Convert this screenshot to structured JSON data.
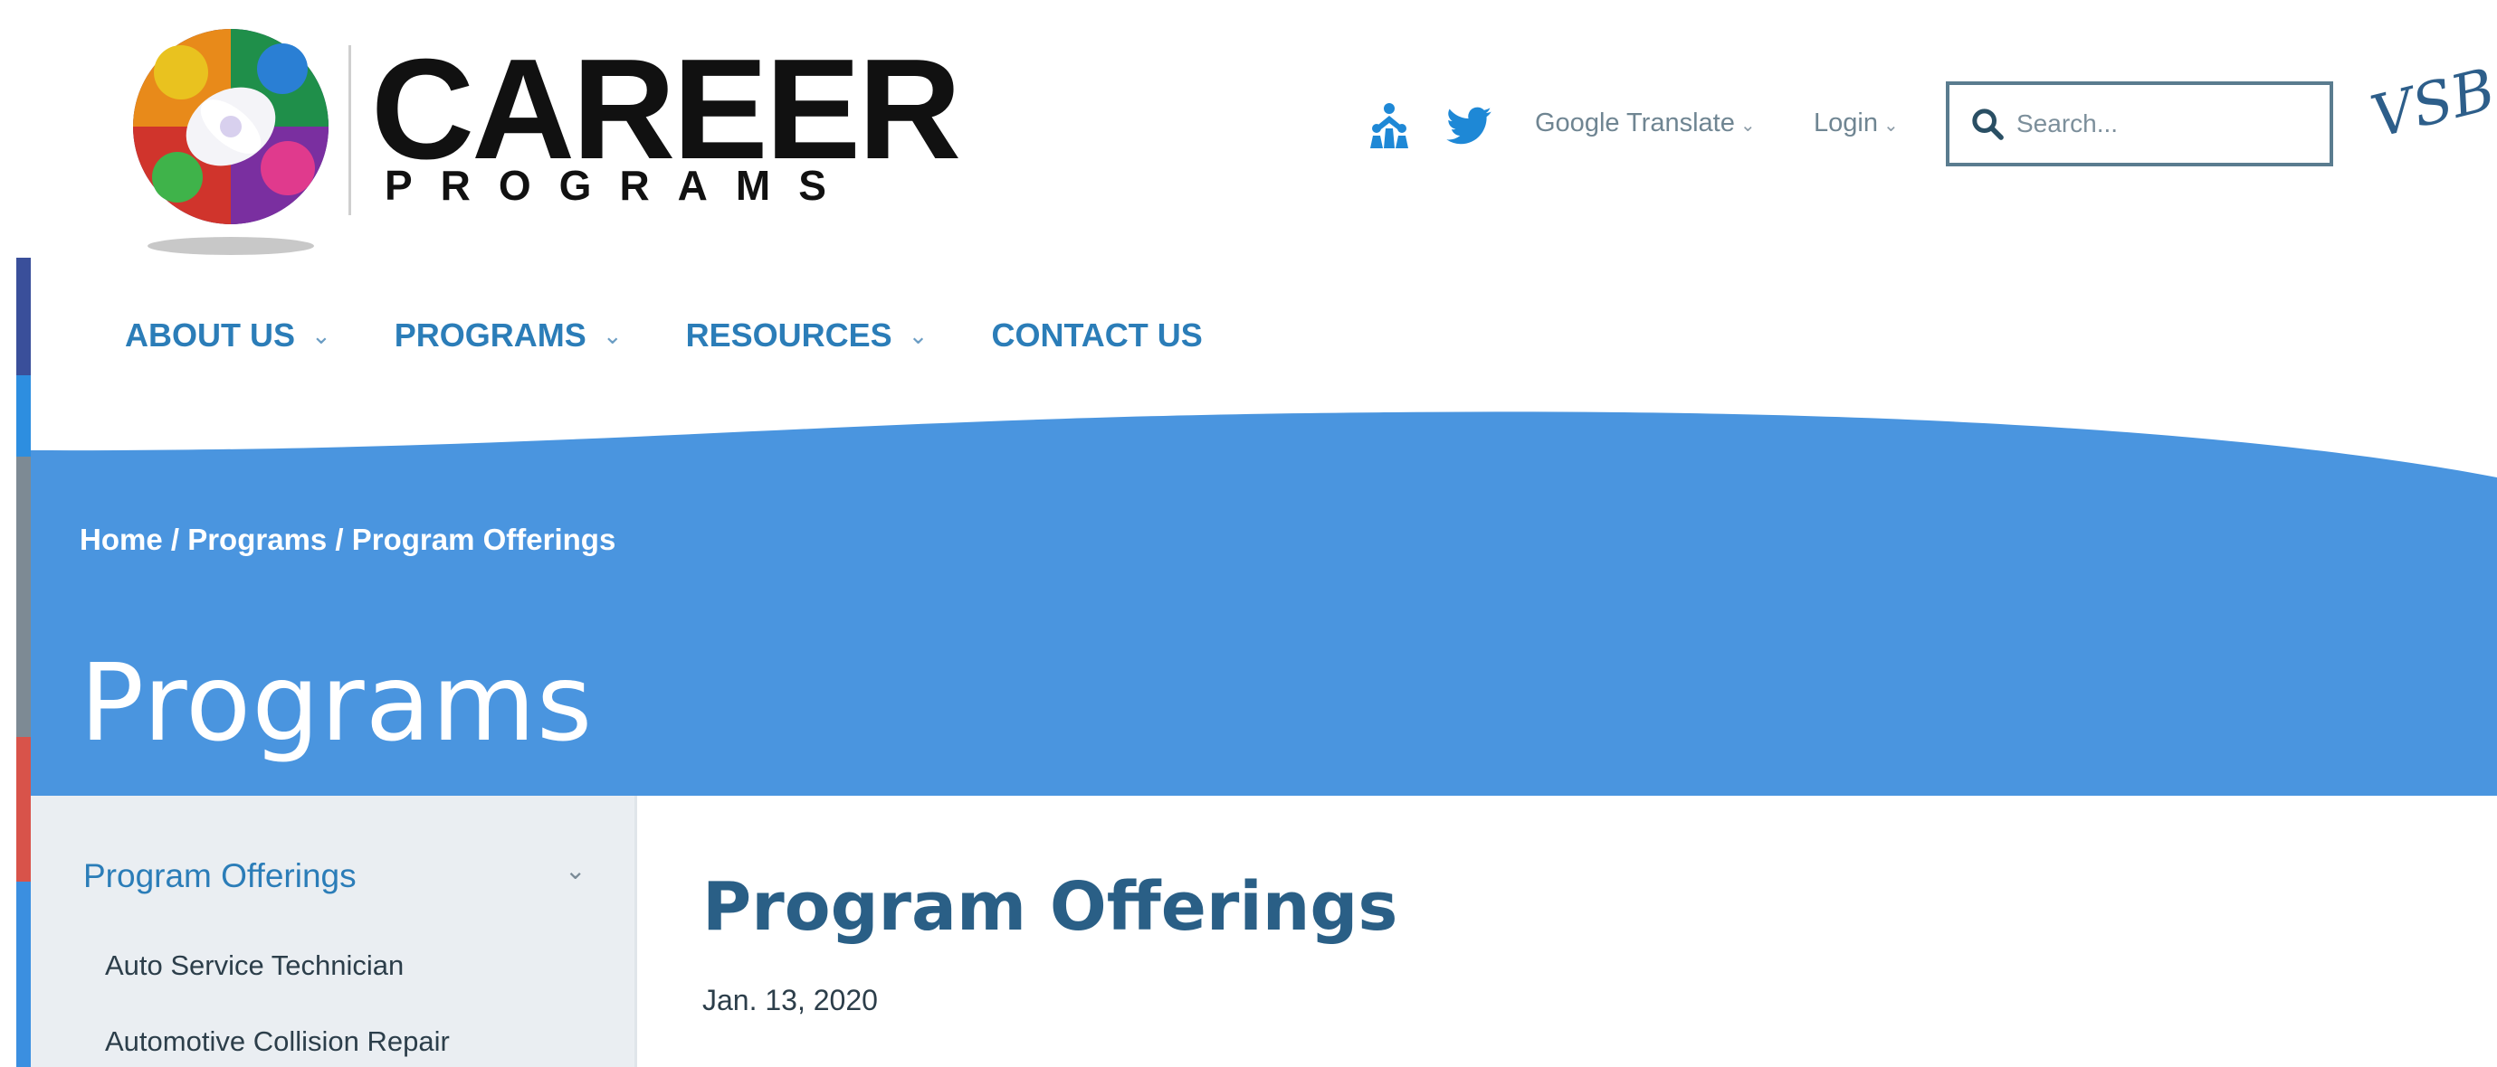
{
  "brand": {
    "name": "CAREER",
    "sub": "PROGRAMS"
  },
  "header": {
    "google_translate_label": "Google Translate",
    "login_label": "Login",
    "search_placeholder": "Search...",
    "vsb_mark": "VSB"
  },
  "nav": {
    "items": [
      {
        "label": "ABOUT US",
        "has_dropdown": true
      },
      {
        "label": "PROGRAMS",
        "has_dropdown": true
      },
      {
        "label": "RESOURCES",
        "has_dropdown": true
      },
      {
        "label": "CONTACT US",
        "has_dropdown": false
      }
    ]
  },
  "banner": {
    "breadcrumb": "Home / Programs / Program Offerings",
    "title": "Programs"
  },
  "sidebar": {
    "heading": "Program Offerings",
    "items": [
      {
        "label": "Auto Service Technician"
      },
      {
        "label": "Automotive Collision Repair"
      }
    ]
  },
  "main": {
    "title": "Program Offerings",
    "date": "Jan. 13, 2020"
  },
  "colors": {
    "banner_blue": "#4a95df",
    "nav_blue": "#2b7db8",
    "title_blue": "#2a5f86",
    "sidebar_bg": "#eaeef2"
  },
  "icons": {
    "accessibility": "people-icon",
    "social": "twitter-icon",
    "search": "search-icon",
    "chevron": "chevron-down-icon"
  }
}
